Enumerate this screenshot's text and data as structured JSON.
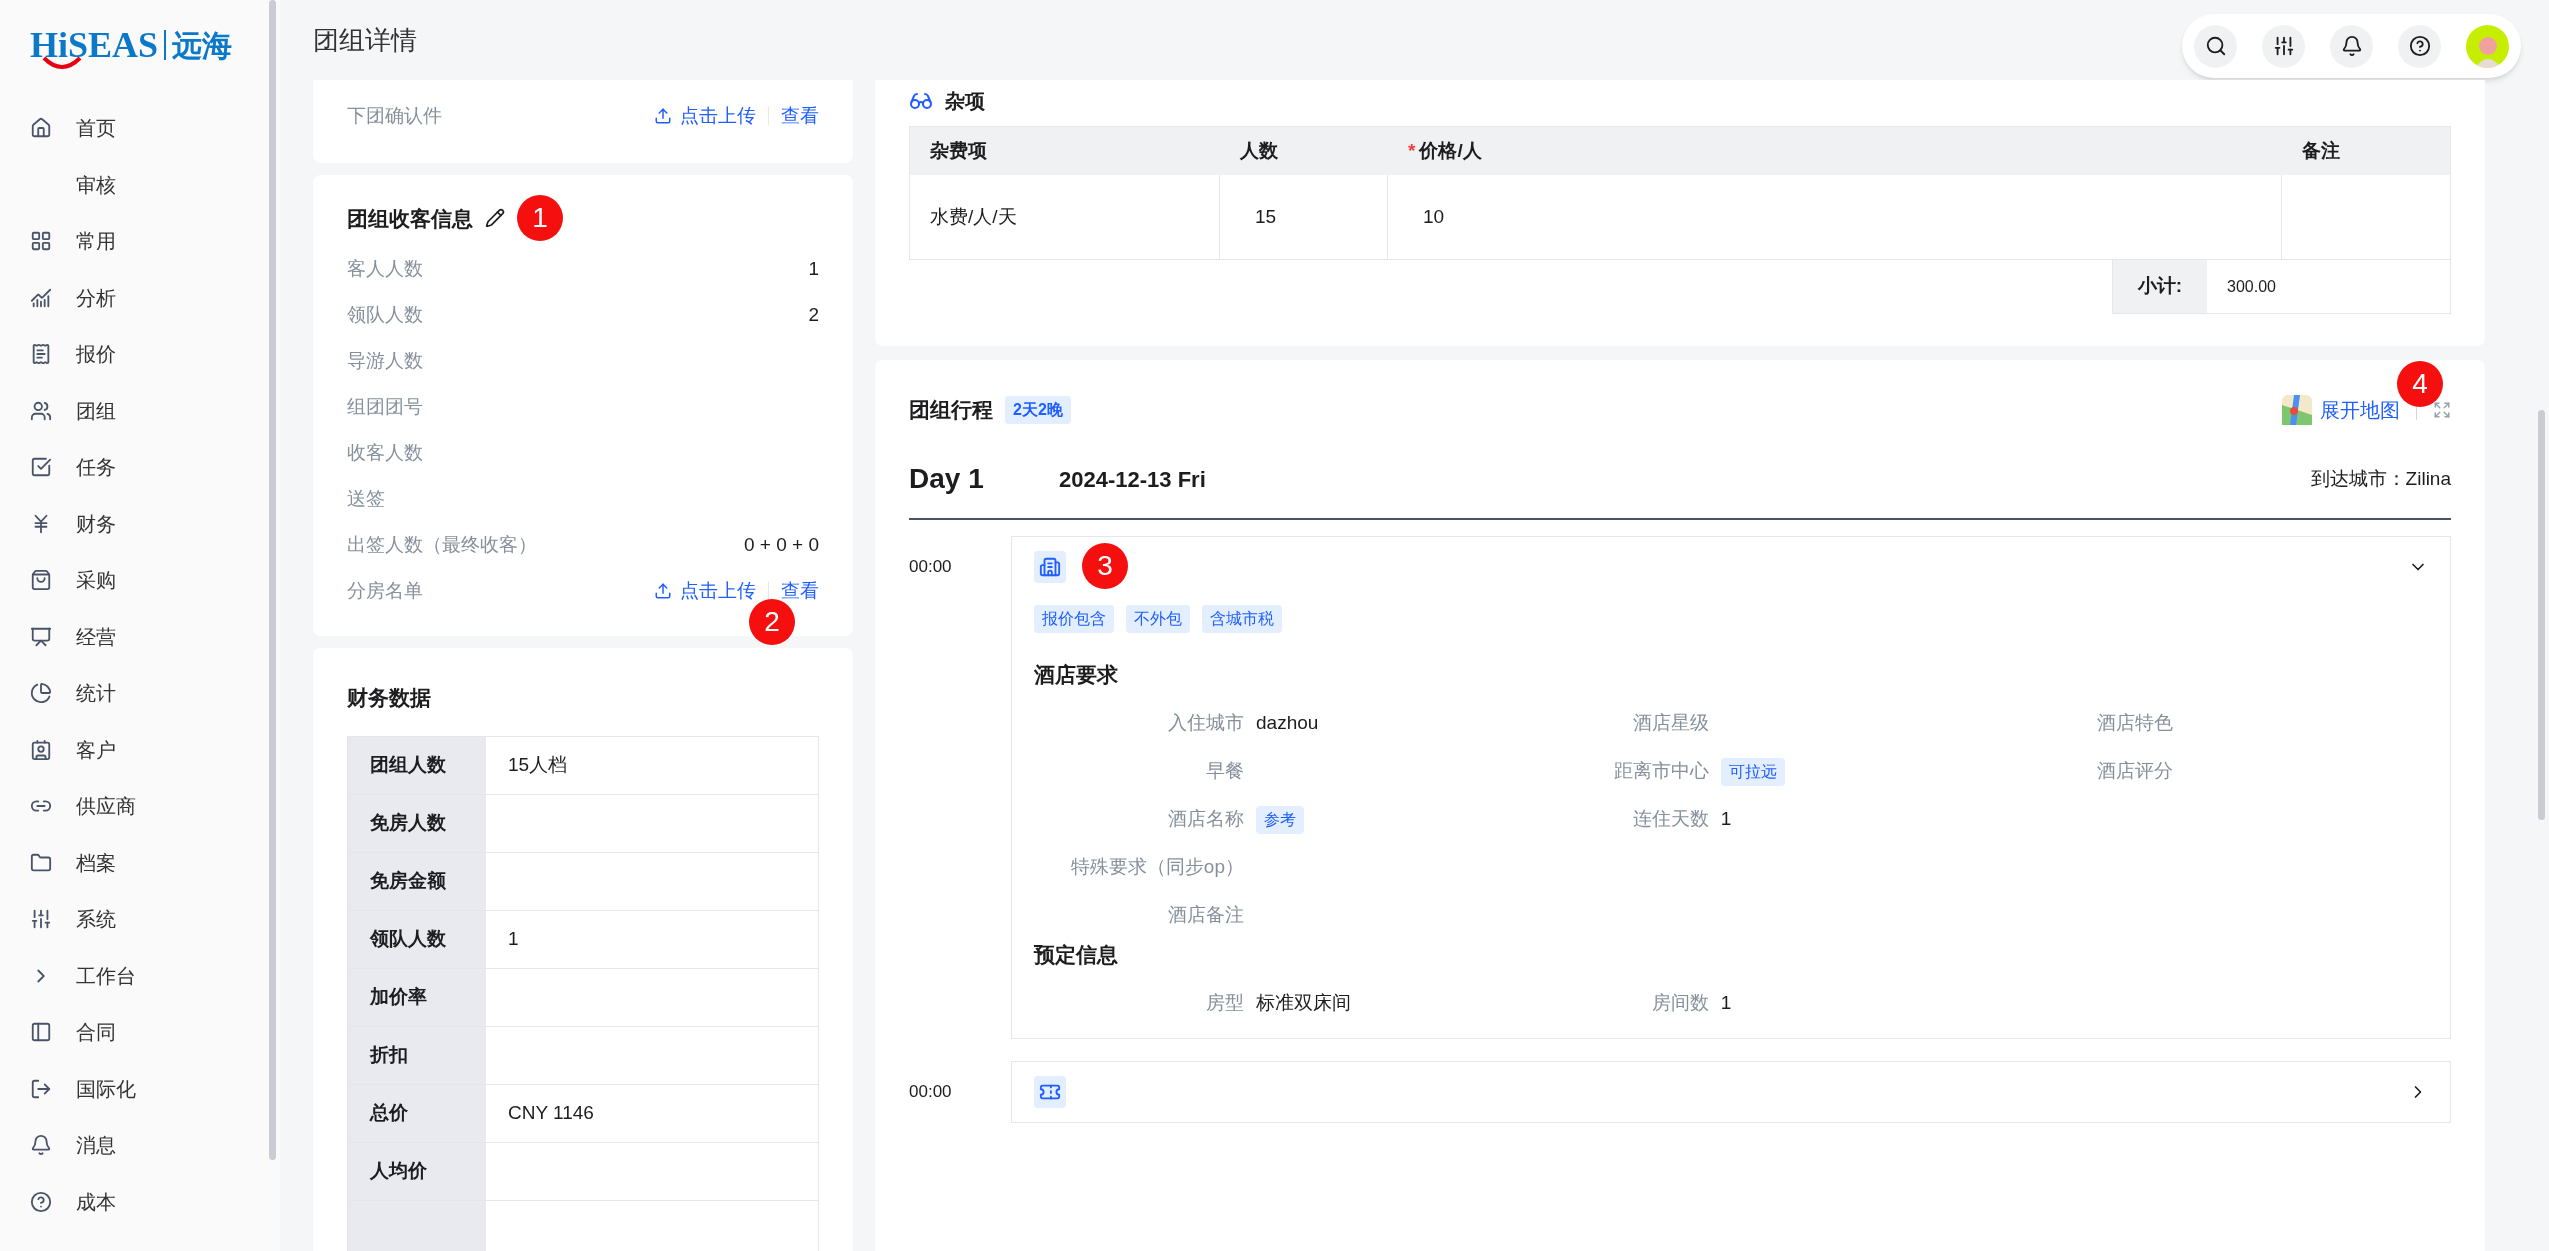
{
  "logo": {
    "brand": "HiSEAS",
    "cn": "远海"
  },
  "sidebar": {
    "items": [
      {
        "label": "首页",
        "selected": false
      },
      {
        "label": "审核",
        "selected": false
      },
      {
        "label": "常用",
        "selected": false
      },
      {
        "label": "分析",
        "selected": false
      },
      {
        "label": "报价",
        "selected": false
      },
      {
        "label": "团组",
        "selected": false
      },
      {
        "label": "任务",
        "selected": false
      },
      {
        "label": "财务",
        "selected": false
      },
      {
        "label": "采购",
        "selected": false
      },
      {
        "label": "经营",
        "selected": false
      },
      {
        "label": "统计",
        "selected": false
      },
      {
        "label": "客户",
        "selected": false
      },
      {
        "label": "供应商",
        "selected": false
      },
      {
        "label": "档案",
        "selected": false
      },
      {
        "label": "系统",
        "selected": false
      },
      {
        "label": "工作台",
        "selected": false
      },
      {
        "label": "合同",
        "selected": false
      },
      {
        "label": "国际化",
        "selected": false
      },
      {
        "label": "消息",
        "selected": false
      },
      {
        "label": "成本",
        "selected": false
      }
    ]
  },
  "header": {
    "title": "团组详情"
  },
  "confirm_card": {
    "label": "下团确认件",
    "upload": "点击上传",
    "view": "查看"
  },
  "receive_card": {
    "title": "团组收客信息",
    "rows": [
      {
        "kind": "text",
        "label": "客人人数",
        "value": "1"
      },
      {
        "kind": "text",
        "label": "领队人数",
        "value": "2"
      },
      {
        "kind": "text",
        "label": "导游人数"
      },
      {
        "kind": "text",
        "label": "组团团号"
      },
      {
        "kind": "text",
        "label": "收客人数"
      },
      {
        "kind": "text",
        "label": "送签"
      },
      {
        "kind": "text",
        "label": "出签人数（最终收客）",
        "value": "0 + 0 + 0"
      },
      {
        "kind": "upload",
        "label": "分房名单",
        "upload": "点击上传",
        "view": "查看"
      }
    ]
  },
  "finance_card": {
    "title": "财务数据",
    "rows": [
      {
        "label": "团组人数",
        "value": "15人档"
      },
      {
        "label": "免房人数"
      },
      {
        "label": "免房金额"
      },
      {
        "label": "领队人数",
        "value": "1"
      },
      {
        "label": "加价率"
      },
      {
        "label": "折扣"
      },
      {
        "label": "总价",
        "value": "CNY 1146"
      },
      {
        "label": "人均价"
      }
    ]
  },
  "misc_card": {
    "title": "杂项",
    "columns": [
      {
        "label": "杂费项"
      },
      {
        "label": "人数"
      },
      {
        "label": "价格/人",
        "mark": "*"
      },
      {
        "label": "备注"
      }
    ],
    "rows": [
      [
        "水费/人/天",
        "15",
        "10"
      ]
    ],
    "subtotal_label": "小计:",
    "subtotal": "300.00"
  },
  "itinerary": {
    "title": "团组行程",
    "duration": "2天2晚",
    "map_link": "展开地图",
    "day": {
      "label": "Day 1",
      "date": "2024-12-13 Fri",
      "arrival": "到达城市：Zilina"
    },
    "entries": [
      {
        "kind": "hotel",
        "time": "00:00",
        "expanded": true,
        "tags": [
          "报价包含",
          "不外包",
          "含城市税"
        ],
        "sections": [
          {
            "title": "酒店要求",
            "rows": [
              [
                {
                  "label": "入住城市",
                  "value": "dazhou"
                },
                {
                  "label": "酒店星级"
                },
                {
                  "label": "酒店特色"
                }
              ],
              [
                {
                  "label": "早餐"
                },
                {
                  "label": "距离市中心",
                  "tag": "可拉远"
                },
                {
                  "label": "酒店评分"
                }
              ],
              [
                {
                  "label": "酒店名称",
                  "tag": "参考"
                },
                {
                  "label": "连住天数",
                  "value": "1"
                }
              ],
              [
                {
                  "label": "特殊要求（同步op）"
                }
              ],
              [
                {
                  "label": "酒店备注"
                }
              ]
            ]
          },
          {
            "title": "预定信息",
            "rows": [
              [
                {
                  "label": "房型",
                  "value": "标准双床间"
                },
                {
                  "label": "房间数",
                  "value": "1"
                }
              ]
            ]
          }
        ]
      },
      {
        "kind": "ticket",
        "time": "00:00",
        "expanded": false
      }
    ]
  },
  "markers": [
    "1",
    "2",
    "3",
    "4"
  ]
}
